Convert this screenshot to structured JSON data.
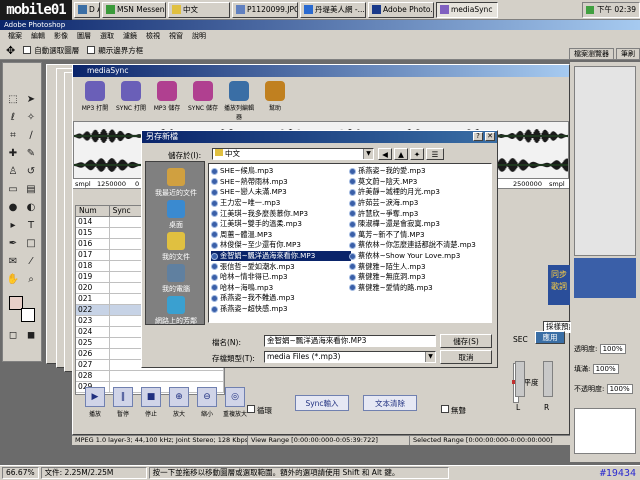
{
  "taskbar": {
    "logo": "mobile01",
    "tasks": [
      {
        "label": "D A"
      },
      {
        "label": "MSN Messeng..."
      },
      {
        "label": "中文"
      },
      {
        "label": "P1120099.JPG..."
      },
      {
        "label": "丹堤美人網 -..."
      },
      {
        "label": "Adobe Photo..."
      },
      {
        "label": "mediaSync"
      }
    ],
    "clock": "下午 02:39"
  },
  "photoshop": {
    "title": "Adobe Photoshop",
    "menu": [
      "檔案",
      "編輯",
      "影像",
      "圖層",
      "選取",
      "濾鏡",
      "檢視",
      "視窗",
      "說明"
    ],
    "options": {
      "auto_select": "自動選取圖層",
      "show_bounds": "顯示邊界方框"
    },
    "tabs": [
      "檔案瀏覽器",
      "筆刷"
    ],
    "zoom": "66.67%",
    "doc_size": "文件: 2.25M/2.25M",
    "hint": "按一下並拖移以移動圖層或選取範圍。額外的選項請使用 Shift 和 Alt 鍵。"
  },
  "mediasync": {
    "title": "mediaSync",
    "toolbar": [
      {
        "label": "MP3 打開",
        "color": "#6a5fb8"
      },
      {
        "label": "SYNC 打開",
        "color": "#6a5fb8"
      },
      {
        "label": "MP3 儲存",
        "color": "#b04090"
      },
      {
        "label": "SYNC 儲存",
        "color": "#b04090"
      },
      {
        "label": "播放列編輯器",
        "color": "#3a6ea5"
      },
      {
        "label": "幫助",
        "color": "#c08020"
      }
    ],
    "ruler_left": "smpl",
    "ruler_labels": [
      "1250000",
      "0",
      "2500000"
    ],
    "table": {
      "headers": [
        "Num",
        "Sync"
      ],
      "rows": [
        "014",
        "015",
        "016",
        "017",
        "018",
        "019",
        "020",
        "021",
        "022",
        "023",
        "024",
        "025",
        "026",
        "027",
        "028",
        "029"
      ]
    },
    "playback": [
      {
        "icon": "▶",
        "label": "播放"
      },
      {
        "icon": "‖",
        "label": "暫停"
      },
      {
        "icon": "■",
        "label": "停止"
      },
      {
        "icon": "⊕",
        "label": "放大"
      },
      {
        "icon": "⊖",
        "label": "縮小"
      },
      {
        "icon": "◎",
        "label": "重複放大"
      }
    ],
    "repeat_label": "循環",
    "sync_input": "Sync輸入",
    "clear_text": "文本清除",
    "volume_label": "水平度",
    "mute_label": "無聲",
    "lr": [
      "L",
      "R"
    ],
    "sec_label": "SEC",
    "apply": "應用",
    "sample_setting": "採樣預設選",
    "right_labels": [
      "同步",
      "歌詞"
    ],
    "status": {
      "format": "MPEG 1.0 layer-3; 44,100 kHz; Joint Stereo; 128 Kbps;",
      "view_range": "View Range [0:00:00:000-0:05:39:722]",
      "selected_range": "Selected Range [0:00:00:000-0:00:00:000]"
    }
  },
  "right_panel": {
    "sizes": [
      "100%",
      "100%",
      "100%"
    ],
    "size_labels": [
      "透明度:",
      "填滿:",
      "不透明度:"
    ],
    "watermark": "#19434"
  },
  "dialog": {
    "title": "另存新檔",
    "save_in_label": "儲存於(I):",
    "folder": "中文",
    "places": [
      "我最近的文件",
      "桌面",
      "我的文件",
      "我的電腦",
      "網路上的芳鄰"
    ],
    "files_col1": [
      "SHE~候鳥.mp3",
      "SHE~熱帶雨林.mp3",
      "SHE~戀人未滿.MP3",
      "王力宏~唯一.mp3",
      "江美琪~我多麼羨慕你.MP3",
      "江美琪~雙手的溫柔.mp3",
      "周蕙~體溫.MP3",
      "林俊傑~至少還有你.MP3",
      "金智娟~飄洋過海來看你.MP3",
      "張信哲~愛如潮水.mp3",
      "哈林~情非得已.mp3",
      "哈林~海鳴.mp3",
      "孫燕姿~我不難過.mp3",
      "孫燕姿~超快感.mp3"
    ],
    "files_col2": [
      "孫燕姿~我的愛.mp3",
      "莫文蔚~陰天.MP3",
      "許美靜~城裡的月光.mp3",
      "許茹芸~淚海.mp3",
      "許慧欣~爭奪.mp3",
      "陳淑樺~還是會寂寞.mp3",
      "萬芳~新不了情.MP3",
      "蔡依林~你怎麼連話都說不清楚.mp3",
      "蔡依林~Show Your Love.mp3",
      "蔡健雅~陌生人.mp3",
      "蔡健雅~無底洞.mp3",
      "蔡健雅~愛情的路.mp3"
    ],
    "selected_index": 8,
    "filename_label": "檔名(N):",
    "filename": "金智娟~飄洋過海來看你.MP3",
    "type_label": "存檔類型(T):",
    "type": "media Files (*.mp3)",
    "save": "儲存(S)",
    "cancel": "取消"
  }
}
